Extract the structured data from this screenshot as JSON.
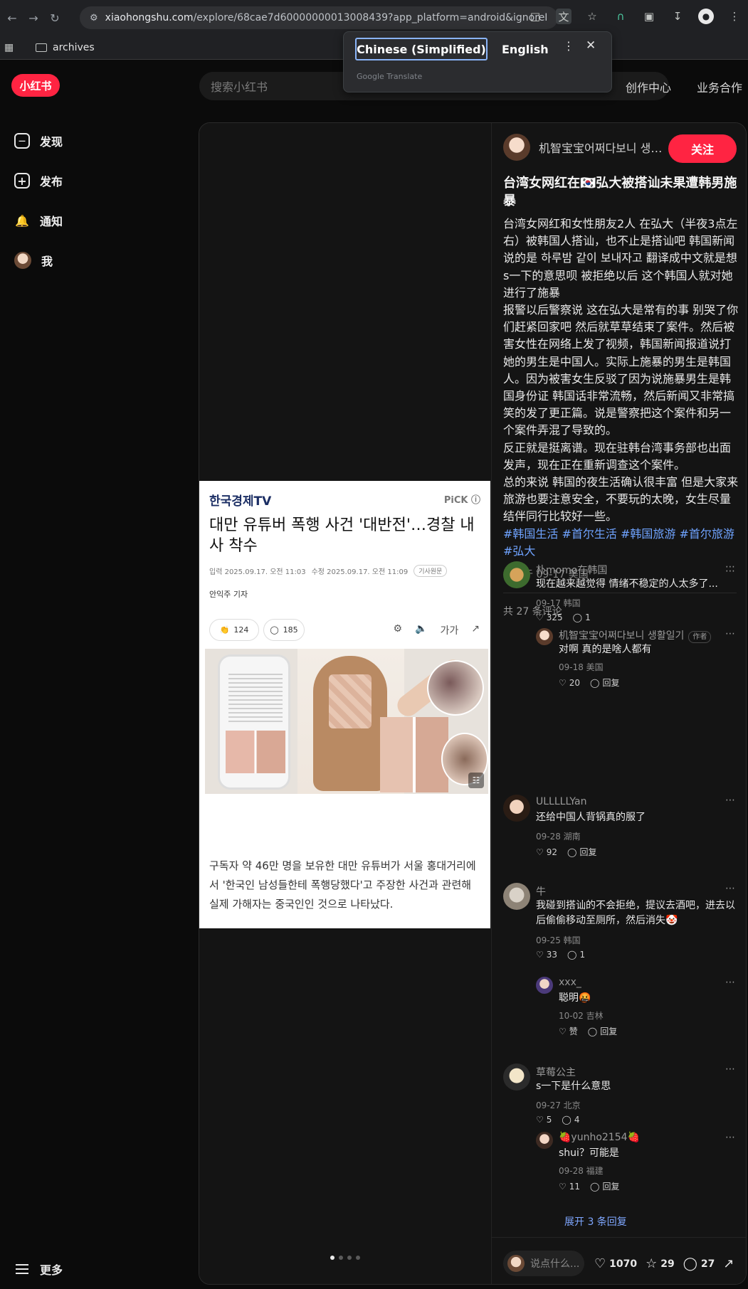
{
  "browser": {
    "url_host": "xiaohongshu.com",
    "url_path": "/explore/68cae7d60000000013008439?app_platform=android&ignoreEnga...",
    "bookmark": "archives"
  },
  "translate": {
    "lang_from": "Chinese (Simplified)",
    "lang_to": "English",
    "brand": "Google Translate"
  },
  "site": {
    "logo": "小红书",
    "search_placeholder": "搜索小红书",
    "header_links": [
      "创作中心",
      "业务合作"
    ]
  },
  "sidebar": {
    "items": [
      {
        "label": "发现",
        "icon": "home-icon"
      },
      {
        "label": "发布",
        "icon": "plus-icon"
      },
      {
        "label": "通知",
        "icon": "bell-icon"
      },
      {
        "label": "我",
        "icon": "avatar"
      }
    ],
    "more": "更多"
  },
  "article": {
    "brand": "한국경제TV",
    "pick": "PiCK ⓘ",
    "title": "대만 유튜버 폭행 사건 '대반전'…경찰 내사 착수",
    "meta_input": "입력 2025.09.17. 오전 11:03",
    "meta_edit": "수정 2025.09.17. 오전 11:09",
    "meta_chip": "기사원문",
    "author": "안익주 기자",
    "reactions": "124",
    "comments": "185",
    "text_size": "가가",
    "body": "구독자 약 46만 명을 보유한 대만 유튜버가 서울 홍대거리에서 '한국인 남성들한테 폭행당했다'고 주장한 사건과 관련해 실제 가해자는 중국인인 것으로 나타났다."
  },
  "note": {
    "author": "机智宝宝어쩌다보니 생활일기",
    "follow": "关注",
    "title": "台湾女网红在🇰🇷弘大被搭讪未果遭韩男施暴",
    "paragraphs": [
      "台湾女网红和女性朋友2人 在弘大（半夜3点左右）被韩国人搭讪，也不止是搭讪吧 韩国新闻说的是 하루밤 같이 보내자고 翻译成中文就是想s一下的意思呗 被拒绝以后 这个韩国人就对她进行了施暴",
      "报警以后警察说 这在弘大是常有的事 别哭了你们赶紧回家吧 然后就草草结束了案件。然后被害女性在网络上发了视频，韩国新闻报道说打她的男生是中国人。实际上施暴的男生是韩国人。因为被害女生反驳了因为说施暴男生是韩国身份证 韩国话非常流畅，然后新闻又非常搞笑的发了更正篇。说是警察把这个案件和另一个案件弄混了导致的。",
      "反正就是挺离谱。现在驻韩台湾事务部也出面发声，现在正在重新调查这个案件。",
      "总的来说 韩国的夜生活确认很丰富 但是大家来旅游也要注意安全，不要玩的太晚，女生尽量结伴同行比较好一些。"
    ],
    "tags": "#韩国生活 #首尔生活 #韩国旅游 #首尔旅游 #弘大",
    "edited": "编辑于 09-17 美国",
    "comment_count": "共 27 条评论"
  },
  "comments": [
    {
      "name": "朴momo在韩国",
      "text": "现在越来越觉得 情绪不稳定的人太多了...",
      "meta": "09-17 韩国",
      "likes": "325",
      "replies": "1"
    },
    {
      "name": "机智宝宝어쩌다보니 생활일기",
      "badge": "作者",
      "text": "对啊 真的是啥人都有",
      "meta": "09-18 美国",
      "likes": "20",
      "replies": "回复"
    },
    {
      "name": "ULLLLLYan",
      "text": "还给中国人背锅真的服了",
      "meta": "09-28 湖南",
      "likes": "92",
      "replies": "回复"
    },
    {
      "name": "牛",
      "text": "我碰到搭讪的不会拒绝，提议去酒吧，进去以后偷偷移动至厕所，然后消失🤡",
      "meta": "09-25 韩国",
      "likes": "33",
      "replies": "1"
    },
    {
      "name": "xxx_",
      "text": "聪明🤬",
      "meta": "10-02 吉林",
      "likes": "赞",
      "replies": "回复"
    },
    {
      "name": "草莓公主",
      "text": "s一下是什么意思",
      "meta": "09-27 北京",
      "likes": "5",
      "replies": "4"
    },
    {
      "name": "🍓yunho2154🍓",
      "text": "shui？可能是",
      "meta": "09-28 福建",
      "likes": "11",
      "replies": "回复"
    }
  ],
  "expand_replies": "展开 3 条回复",
  "bottom": {
    "say_placeholder": "说点什么...",
    "likes": "1070",
    "collects": "29",
    "comments": "27"
  }
}
